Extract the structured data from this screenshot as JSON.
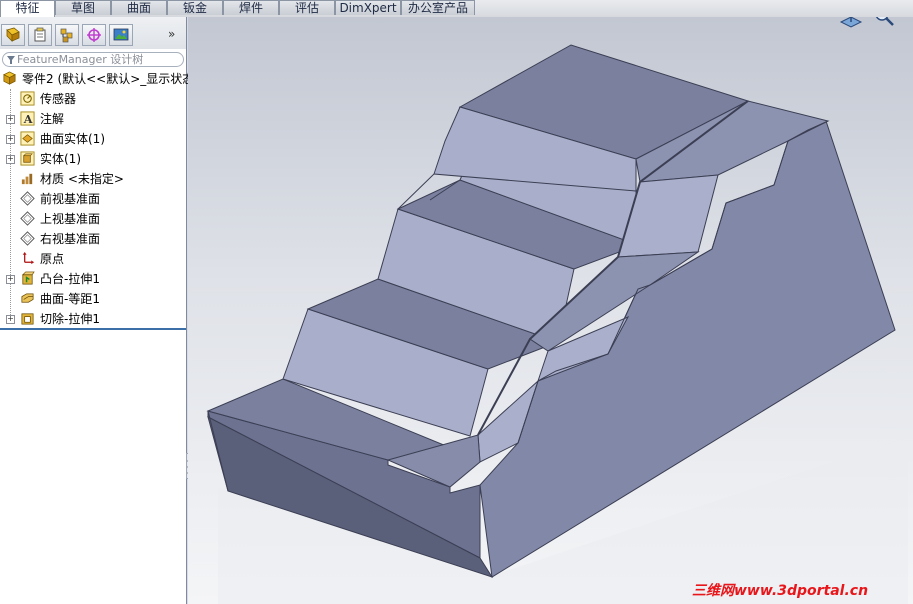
{
  "tabs": [
    {
      "label": "特征",
      "active": true
    },
    {
      "label": "草图",
      "active": false
    },
    {
      "label": "曲面",
      "active": false
    },
    {
      "label": "钣金",
      "active": false
    },
    {
      "label": "焊件",
      "active": false
    },
    {
      "label": "评估",
      "active": false
    },
    {
      "label": "DimXpert",
      "active": false
    },
    {
      "label": "办公室产品",
      "active": false
    }
  ],
  "panel": {
    "expand_glyph": "»",
    "filter_text": "FeatureManager 设计树",
    "toolbar_icons": [
      "feature-manager-tree-icon",
      "property-manager-icon",
      "configuration-manager-icon",
      "dimxpert-manager-icon",
      "display-manager-icon"
    ]
  },
  "tree": {
    "root": "零件2 (默认<<默认>_显示状态",
    "items": [
      {
        "label": "传感器",
        "icon": "sensor-icon",
        "expandable": false
      },
      {
        "label": "注解",
        "icon": "annotation-icon",
        "expandable": true
      },
      {
        "label": "曲面实体(1)",
        "icon": "surface-body-icon",
        "expandable": true
      },
      {
        "label": "实体(1)",
        "icon": "solid-body-icon",
        "expandable": true
      },
      {
        "label": "材质 <未指定>",
        "icon": "material-icon",
        "expandable": false
      },
      {
        "label": "前视基准面",
        "icon": "plane-icon",
        "expandable": false
      },
      {
        "label": "上视基准面",
        "icon": "plane-icon",
        "expandable": false
      },
      {
        "label": "右视基准面",
        "icon": "plane-icon",
        "expandable": false
      },
      {
        "label": "原点",
        "icon": "origin-icon",
        "expandable": false
      },
      {
        "label": "凸台-拉伸1",
        "icon": "boss-extrude-icon",
        "expandable": true
      },
      {
        "label": "曲面-等距1",
        "icon": "offset-surface-icon",
        "expandable": false
      },
      {
        "label": "切除-拉伸1",
        "icon": "cut-extrude-icon",
        "expandable": true
      }
    ]
  },
  "viewport": {
    "heads_up_icons": [
      "view-orientation-icon",
      "zoom-to-fit-icon"
    ],
    "model_color": "#7f86a3"
  },
  "watermark": "三维网www.3dportal.cn"
}
